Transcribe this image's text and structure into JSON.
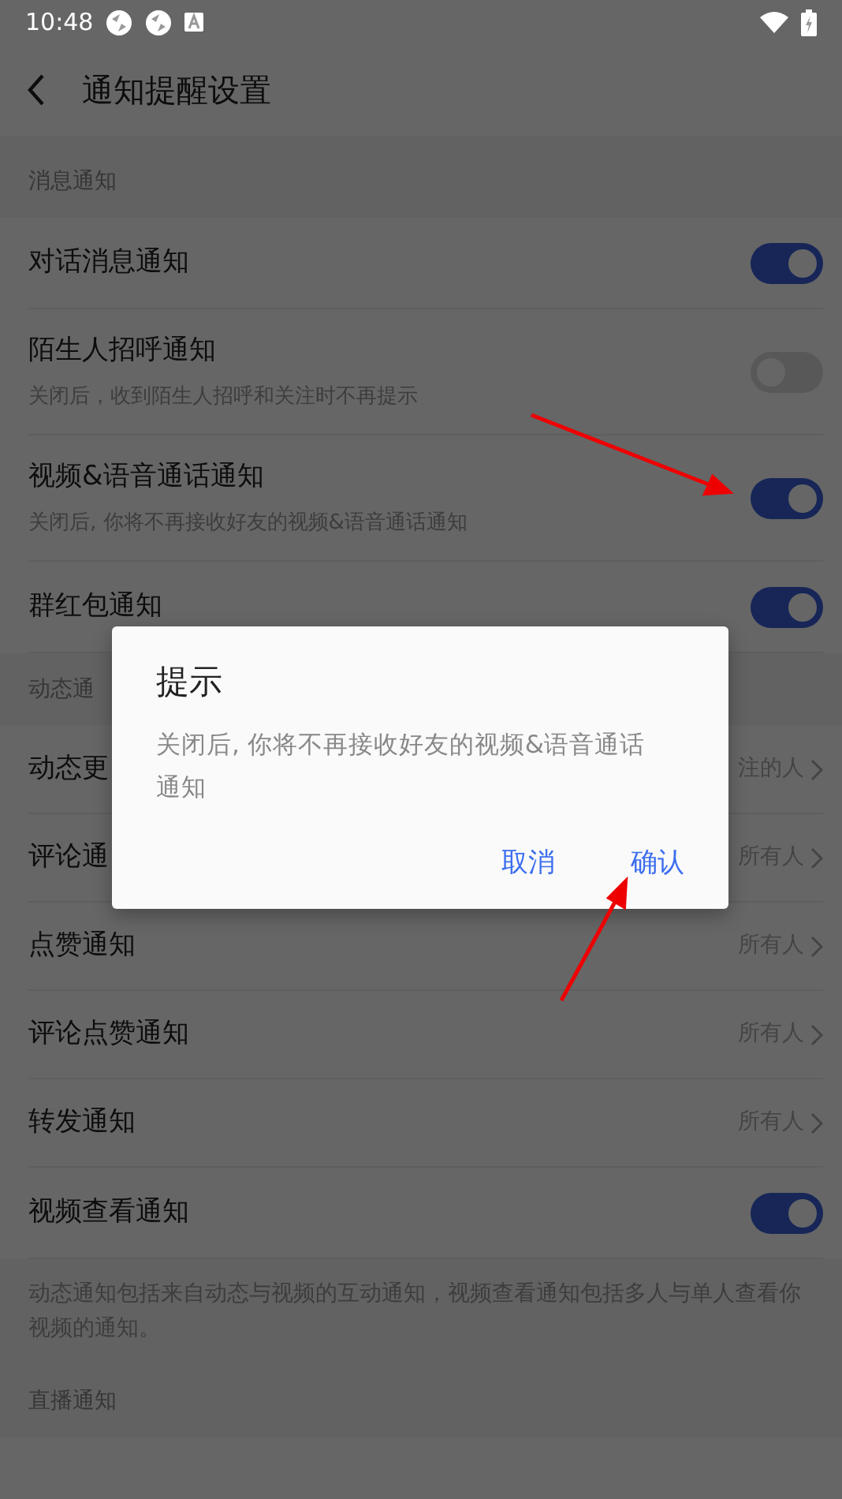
{
  "status_bar": {
    "time": "10:48"
  },
  "header": {
    "title": "通知提醒设置"
  },
  "sections": [
    {
      "label": "消息通知",
      "items": [
        {
          "kind": "toggle",
          "title": "对话消息通知",
          "on": true
        },
        {
          "kind": "toggle",
          "title": "陌生人招呼通知",
          "subtitle": "关闭后，收到陌生人招呼和关注时不再提示",
          "on": false
        },
        {
          "kind": "toggle",
          "title": "视频&语音通话通知",
          "subtitle": "关闭后, 你将不再接收好友的视频&语音通话通知",
          "on": true
        },
        {
          "kind": "toggle",
          "title": "群红包通知",
          "on": true
        }
      ]
    },
    {
      "label": "动态通",
      "items": [
        {
          "kind": "link",
          "title": "动态更",
          "value": "注的人"
        },
        {
          "kind": "link",
          "title": "评论通",
          "value": "所有人"
        },
        {
          "kind": "link",
          "title": "点赞通知",
          "value": "所有人"
        },
        {
          "kind": "link",
          "title": "评论点赞通知",
          "value": "所有人"
        },
        {
          "kind": "link",
          "title": "转发通知",
          "value": "所有人"
        },
        {
          "kind": "toggle",
          "title": "视频查看通知",
          "on": true
        }
      ],
      "footnote": "动态通知包括来自动态与视频的互动通知，视频查看通知包括多人与单人查看你视频的通知。"
    },
    {
      "label": "直播通知"
    }
  ],
  "dialog": {
    "title": "提示",
    "message": "关闭后, 你将不再接收好友的视频&语音通话通知",
    "buttons": [
      "取消",
      "确认"
    ]
  }
}
